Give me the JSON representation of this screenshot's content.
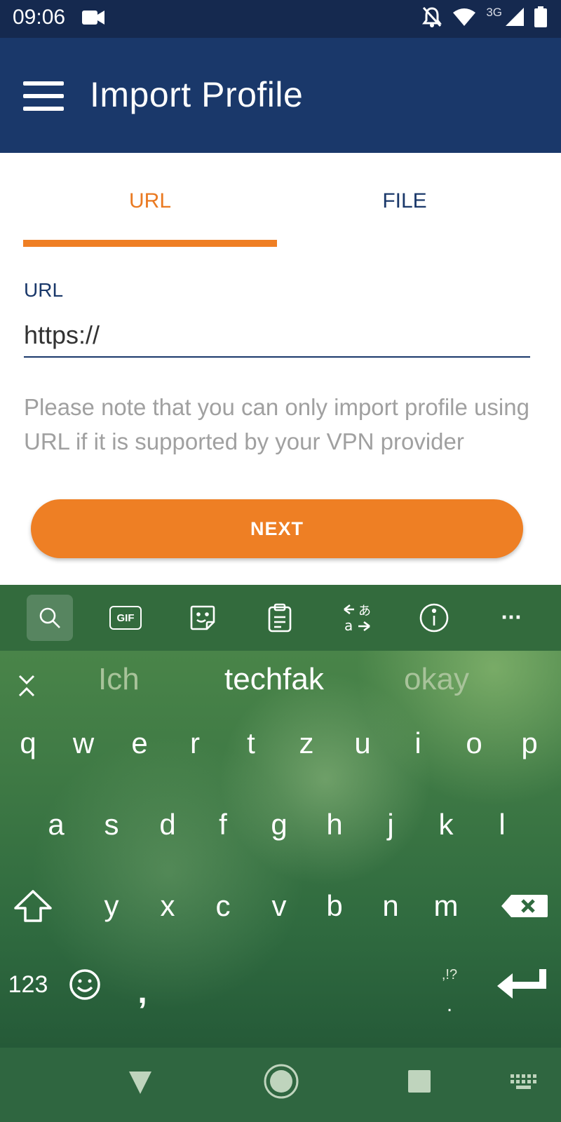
{
  "status_bar": {
    "time": "09:06",
    "network": "3G",
    "icons": [
      "video-camera-icon",
      "notifications-off-icon",
      "wifi-icon",
      "signal-icon",
      "battery-icon"
    ]
  },
  "app_bar": {
    "title": "Import Profile",
    "menu_icon": "hamburger-menu-icon"
  },
  "tabs": [
    {
      "label": "URL",
      "selected": true
    },
    {
      "label": "FILE",
      "selected": false
    }
  ],
  "url_field": {
    "label": "URL",
    "value": "https://"
  },
  "note": "Please note that you can only import profile using URL if it is supported by your VPN provider",
  "next_button": {
    "label": "NEXT"
  },
  "keyboard": {
    "toolbar": [
      "search-icon",
      "gif-icon",
      "sticker-icon",
      "clipboard-icon",
      "translate-icon",
      "info-icon",
      "more-icon"
    ],
    "gif_label": "GIF",
    "more_label": "···",
    "suggestions": [
      "Ich",
      "techfak",
      "okay"
    ],
    "rows": [
      [
        "q",
        "w",
        "e",
        "r",
        "t",
        "z",
        "u",
        "i",
        "o",
        "p"
      ],
      [
        "a",
        "s",
        "d",
        "f",
        "g",
        "h",
        "j",
        "k",
        "l"
      ],
      [
        "y",
        "x",
        "c",
        "v",
        "b",
        "n",
        "m"
      ]
    ],
    "numbers_key": "123",
    "comma_key": ",",
    "punct_hint": ",!?",
    "period_key": "."
  },
  "colors": {
    "primary": "#1a386a",
    "accent": "#ee7f24",
    "status_bar": "#15294f"
  }
}
